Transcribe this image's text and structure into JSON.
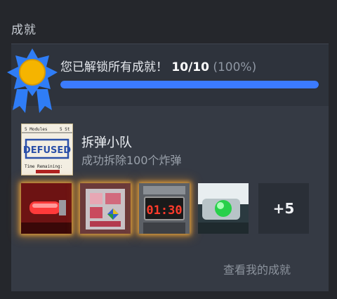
{
  "section": {
    "title": "成就"
  },
  "progress": {
    "message": "您已解锁所有成就！",
    "count": "10/10",
    "percent": "(100%)",
    "fraction": 1.0,
    "bar_color": "#3b7bff"
  },
  "game": {
    "name": "拆弹小队",
    "description": "成功拆除100个炸弹",
    "thumb_icon": "defused-logo-icon",
    "thumb_text": {
      "top_left": "5 Modules",
      "top_right": "5 St",
      "stamp": "DEFUSED",
      "footer": "Time Remaining:"
    }
  },
  "achievements": [
    {
      "icon": "red-alarm-light-icon",
      "unlocked": true
    },
    {
      "icon": "bomb-module-panel-icon",
      "unlocked": true
    },
    {
      "icon": "bomb-timer-display-icon",
      "unlocked": true
    },
    {
      "icon": "green-button-device-icon",
      "unlocked": false
    }
  ],
  "timer_text": "01:30",
  "more": {
    "label": "+5"
  },
  "footer": {
    "view_link": "查看我的成就"
  },
  "colors": {
    "glow": "#f0aa3c",
    "medal": "#2f7df6",
    "medal_center": "#f5b400"
  }
}
